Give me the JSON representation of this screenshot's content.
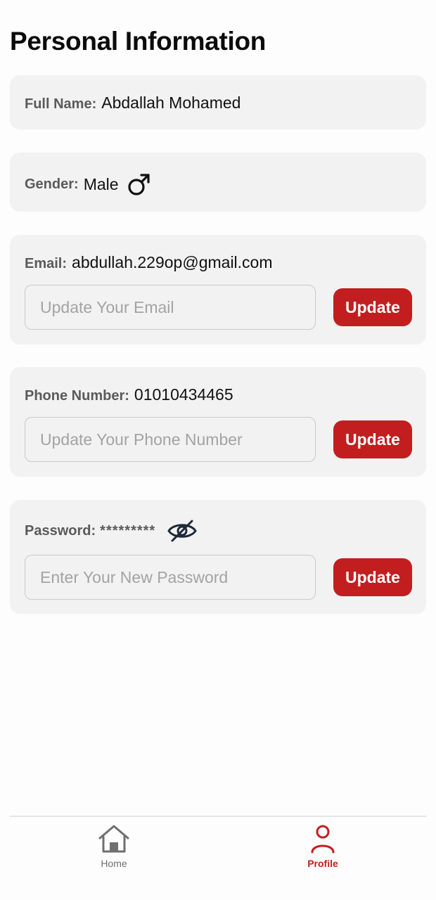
{
  "page": {
    "title": "Personal Information"
  },
  "full_name": {
    "label": "Full Name:",
    "value": "Abdallah Mohamed"
  },
  "gender": {
    "label": "Gender:",
    "value": "Male",
    "icon": "male-symbol-icon"
  },
  "email": {
    "label": "Email:",
    "value": "abdullah.229op@gmail.com",
    "placeholder": "Update Your Email",
    "button": "Update"
  },
  "phone": {
    "label": "Phone Number:",
    "value": "01010434465",
    "placeholder": "Update Your Phone Number",
    "button": "Update"
  },
  "password": {
    "label": "Password:",
    "value": "*********",
    "icon": "eye-off-icon",
    "placeholder": "Enter Your New Password",
    "button": "Update"
  },
  "nav": {
    "items": [
      {
        "label": "Home",
        "icon": "home-icon",
        "active": false
      },
      {
        "label": "Profile",
        "icon": "user-icon",
        "active": true
      }
    ]
  },
  "colors": {
    "accent": "#c31e1f",
    "card": "#f2f2f2",
    "muted": "#5a5a5a"
  }
}
